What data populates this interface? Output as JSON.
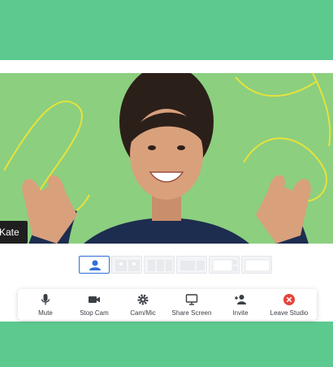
{
  "participant": {
    "name": "Kate"
  },
  "toolbar": {
    "mute": "Mute",
    "stop_cam": "Stop Cam",
    "cam_mic": "Cam/Mic",
    "share_screen": "Share Screen",
    "invite": "Invite",
    "leave_studio": "Leave Studio"
  },
  "colors": {
    "background": "#5cc98f",
    "video_backdrop": "#8ccf7f",
    "doodle": "#e6e23c",
    "active_layout": "#2f6fd8",
    "leave": "#e5433b"
  },
  "icons": [
    "microphone-icon",
    "video-camera-icon",
    "gear-icon",
    "monitor-icon",
    "add-user-icon",
    "close-circle-icon",
    "person-icon"
  ]
}
